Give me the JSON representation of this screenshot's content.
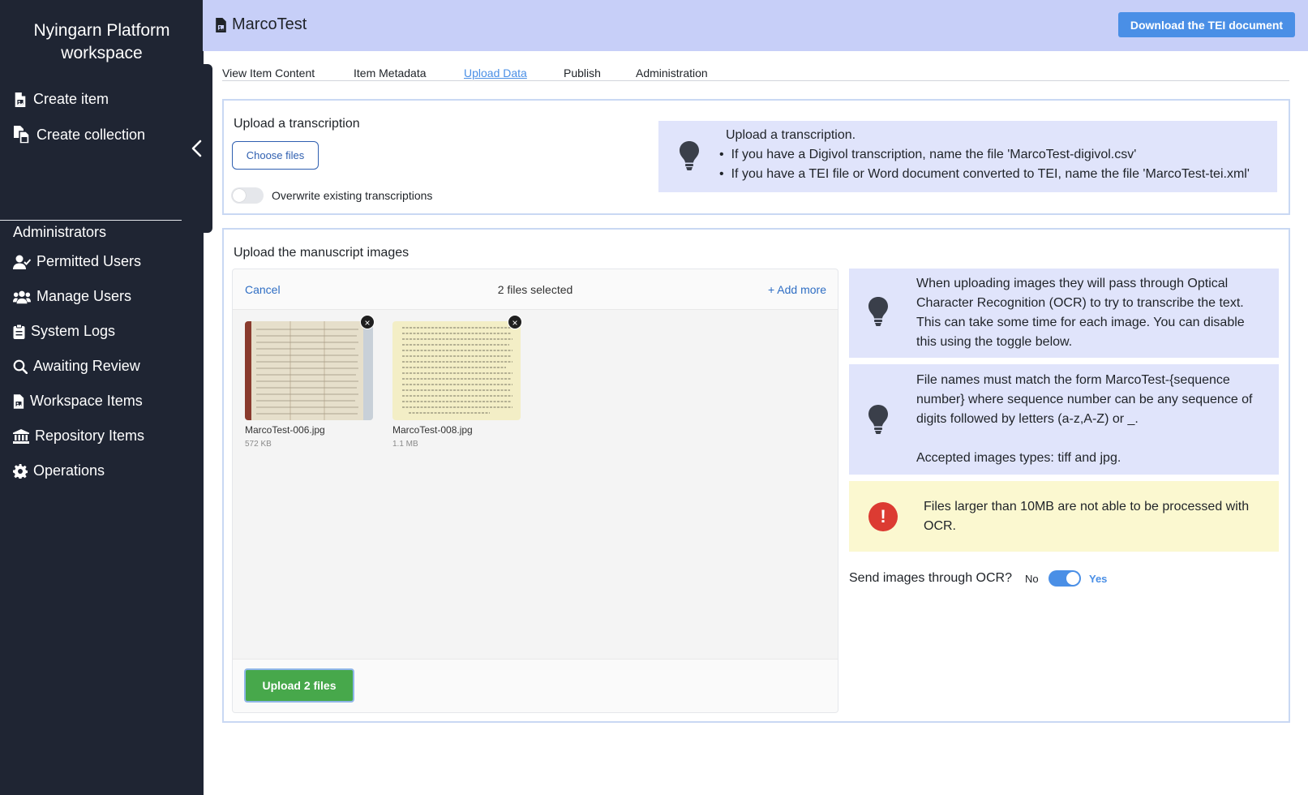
{
  "sidebar": {
    "title_line1": "Nyingarn Platform",
    "title_line2": "workspace",
    "create_item": "Create item",
    "create_collection": "Create collection",
    "admin_heading": "Administrators",
    "items": [
      {
        "label": "Permitted Users",
        "icon": "user-check-icon"
      },
      {
        "label": "Manage Users",
        "icon": "users-icon"
      },
      {
        "label": "System Logs",
        "icon": "clipboard-icon"
      },
      {
        "label": "Awaiting Review",
        "icon": "search-icon"
      },
      {
        "label": "Workspace Items",
        "icon": "file-image-icon"
      },
      {
        "label": "Repository Items",
        "icon": "bank-icon"
      },
      {
        "label": "Operations",
        "icon": "gear-icon"
      }
    ]
  },
  "header": {
    "title": "MarcoTest",
    "download_label": "Download the TEI document"
  },
  "tabs": [
    {
      "label": "View Item Content",
      "active": false
    },
    {
      "label": "Item Metadata",
      "active": false
    },
    {
      "label": "Upload Data",
      "active": true
    },
    {
      "label": "Publish",
      "active": false
    },
    {
      "label": "Administration",
      "active": false
    }
  ],
  "transcription": {
    "heading": "Upload a transcription",
    "choose_files": "Choose files",
    "overwrite_label": "Overwrite existing transcriptions",
    "overwrite_on": false,
    "info_title": "Upload a transcription.",
    "info_bullets": [
      "If you have a Digivol transcription, name the file 'MarcoTest-digivol.csv'",
      "If you have a TEI file or Word document converted to TEI, name the file 'MarcoTest-tei.xml'"
    ]
  },
  "images": {
    "heading": "Upload the manuscript images",
    "cancel": "Cancel",
    "selected_count": "2 files selected",
    "add_more": "+ Add more",
    "files": [
      {
        "name": "MarcoTest-006.jpg",
        "size": "572 KB"
      },
      {
        "name": "MarcoTest-008.jpg",
        "size": "1.1 MB"
      }
    ],
    "upload_button": "Upload 2 files",
    "ocr_info": "When uploading images they will pass through Optical Character Recognition (OCR) to try to transcribe the text. This can take some time for each image. You can disable this using the toggle below.",
    "naming_info": "File names must match the form MarcoTest-{sequence number} where sequence number can be any sequence of digits followed by letters (a-z,A-Z) or _.",
    "accepted_types": "Accepted images types: tiff and jpg.",
    "warning": "Files larger than 10MB are not able to be processed with OCR.",
    "ocr_question": "Send images through OCR?",
    "ocr_no": "No",
    "ocr_yes": "Yes",
    "ocr_enabled": true
  },
  "colors": {
    "sidebar_bg": "#1f2533",
    "header_bg": "#c7cff8",
    "accent": "#4a8fe6",
    "info_bg": "#e0e4fb",
    "warning_bg": "#fbf8d0",
    "error_red": "#dc3b32",
    "upload_green": "#47a84b"
  }
}
